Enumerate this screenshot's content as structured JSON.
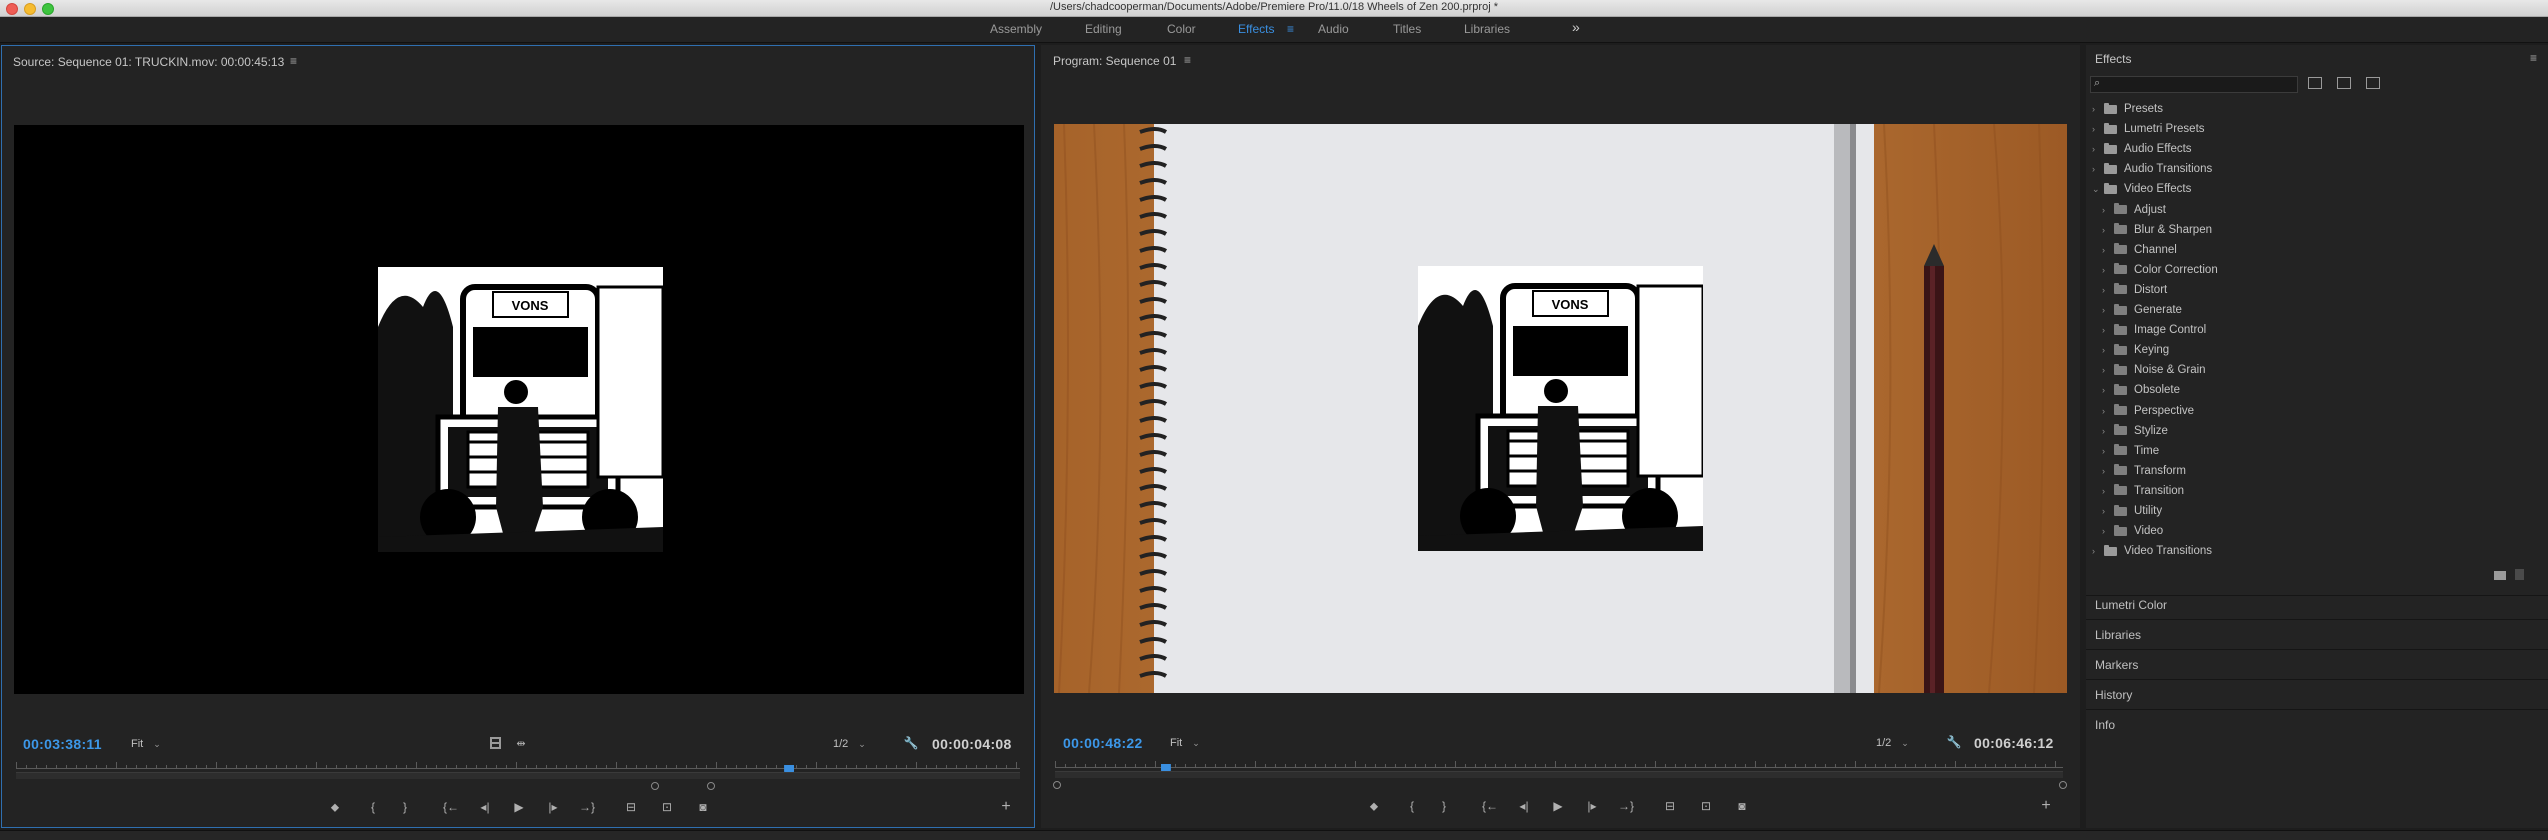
{
  "window": {
    "title": "/Users/chadcooperman/Documents/Adobe/Premiere Pro/11.0/18 Wheels of Zen 200.prproj *"
  },
  "workspaces": {
    "items": [
      "Assembly",
      "Editing",
      "Color",
      "Effects",
      "Audio",
      "Titles",
      "Libraries"
    ],
    "active": "Effects",
    "active_menu": "≡",
    "overflow": "»"
  },
  "source_monitor": {
    "title": "Source: Sequence 01: TRUCKIN.mov: 00:00:45:13",
    "menu": "≡",
    "current_timecode": "00:03:38:11",
    "zoom": "Fit",
    "resolution": "1/2",
    "duration": "00:00:04:08",
    "playhead_position": 0.77
  },
  "program_monitor": {
    "title": "Program: Sequence 01",
    "menu": "≡",
    "current_timecode": "00:00:48:22",
    "zoom": "Fit",
    "resolution": "1/2",
    "duration": "00:06:46:12",
    "playhead_position": 0.11
  },
  "controls": {
    "marker": "⬥",
    "mark_in": "{",
    "mark_out": "}",
    "go_to_in": "{←",
    "step_back": "◂|",
    "play": "▶",
    "step_forward": "|▸",
    "go_to_out": "→}",
    "insert": "⊟",
    "overwrite": "⊡",
    "export_frame": "◙",
    "add": "+"
  },
  "truck_image": {
    "sign": "VONS"
  },
  "effects_panel": {
    "title": "Effects",
    "menu": "≡",
    "search_placeholder": "",
    "tree": [
      {
        "label": "Presets",
        "level": 0,
        "expanded": false
      },
      {
        "label": "Lumetri Presets",
        "level": 0,
        "expanded": false
      },
      {
        "label": "Audio Effects",
        "level": 0,
        "expanded": false
      },
      {
        "label": "Audio Transitions",
        "level": 0,
        "expanded": false
      },
      {
        "label": "Video Effects",
        "level": 0,
        "expanded": true
      },
      {
        "label": "Adjust",
        "level": 1,
        "expanded": false
      },
      {
        "label": "Blur & Sharpen",
        "level": 1,
        "expanded": false
      },
      {
        "label": "Channel",
        "level": 1,
        "expanded": false
      },
      {
        "label": "Color Correction",
        "level": 1,
        "expanded": false
      },
      {
        "label": "Distort",
        "level": 1,
        "expanded": false
      },
      {
        "label": "Generate",
        "level": 1,
        "expanded": false
      },
      {
        "label": "Image Control",
        "level": 1,
        "expanded": false
      },
      {
        "label": "Keying",
        "level": 1,
        "expanded": false
      },
      {
        "label": "Noise & Grain",
        "level": 1,
        "expanded": false
      },
      {
        "label": "Obsolete",
        "level": 1,
        "expanded": false
      },
      {
        "label": "Perspective",
        "level": 1,
        "expanded": false
      },
      {
        "label": "Stylize",
        "level": 1,
        "expanded": false
      },
      {
        "label": "Time",
        "level": 1,
        "expanded": false
      },
      {
        "label": "Transform",
        "level": 1,
        "expanded": false
      },
      {
        "label": "Transition",
        "level": 1,
        "expanded": false
      },
      {
        "label": "Utility",
        "level": 1,
        "expanded": false
      },
      {
        "label": "Video",
        "level": 1,
        "expanded": false
      },
      {
        "label": "Video Transitions",
        "level": 0,
        "expanded": false
      }
    ]
  },
  "collapsed_panels": [
    "Lumetri Color",
    "Libraries",
    "Markers",
    "History",
    "Info"
  ],
  "colors": {
    "accent": "#3a8fe0",
    "background": "#1d1d1d",
    "panel": "#232323",
    "wood": "#b8732e",
    "paper": "#e6e7ea"
  }
}
